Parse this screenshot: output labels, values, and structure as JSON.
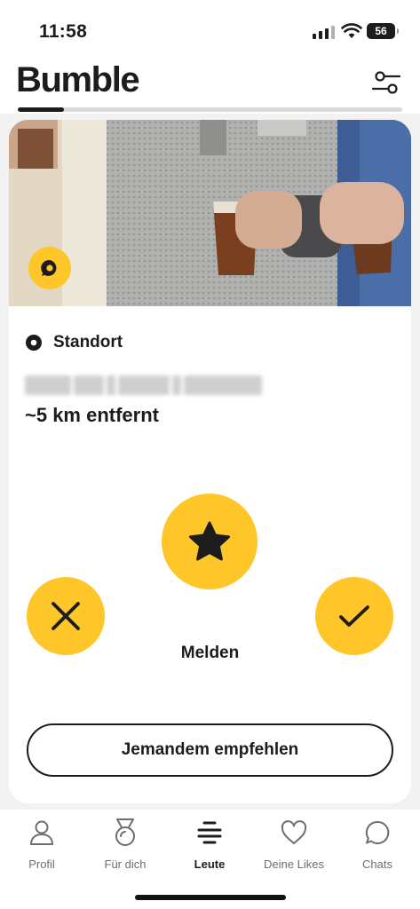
{
  "status_bar": {
    "time": "11:58",
    "battery": "56"
  },
  "header": {
    "logo": "Bumble",
    "filter_icon": "sliders-icon",
    "progress": 0.12
  },
  "profile": {
    "location_title": "Standort",
    "location_icon": "location-pin-icon",
    "distance": "~5 km entfernt"
  },
  "actions": {
    "superswipe_icon": "star-icon",
    "pass_icon": "close-icon",
    "like_icon": "checkmark-icon",
    "report_label": "Melden",
    "recommend_label": "Jemandem empfehlen"
  },
  "tabs": [
    {
      "label": "Profil",
      "icon": "person-icon",
      "active": false
    },
    {
      "label": "Für dich",
      "icon": "medal-icon",
      "active": false
    },
    {
      "label": "Leute",
      "icon": "stack-icon",
      "active": true
    },
    {
      "label": "Deine Likes",
      "icon": "heart-icon",
      "active": false
    },
    {
      "label": "Chats",
      "icon": "chat-bubble-icon",
      "active": false
    }
  ],
  "colors": {
    "accent": "#ffc629",
    "text": "#1c1c1c",
    "background": "#f2f2f2"
  }
}
